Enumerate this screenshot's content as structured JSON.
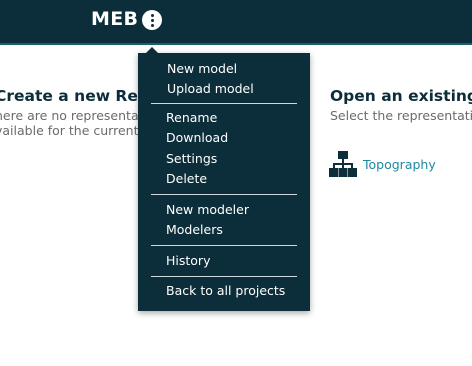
{
  "header": {
    "project_title": "MEB"
  },
  "left_section": {
    "heading": "Create a new Repr",
    "description_line1": "here are no representa",
    "description_line2": "vailable for the current"
  },
  "right_section": {
    "heading": "Open an existing R",
    "description": "Select the representation"
  },
  "representations": [
    {
      "label": "Topography",
      "icon": "hierarchy-icon"
    }
  ],
  "menu": {
    "groups": [
      [
        {
          "label": "New model"
        },
        {
          "label": "Upload model"
        }
      ],
      [
        {
          "label": "Rename"
        },
        {
          "label": "Download"
        },
        {
          "label": "Settings"
        },
        {
          "label": "Delete"
        }
      ],
      [
        {
          "label": "New modeler"
        },
        {
          "label": "Modelers"
        }
      ],
      [
        {
          "label": "History"
        }
      ],
      [
        {
          "label": "Back to all projects"
        }
      ]
    ]
  },
  "colors": {
    "header_bg": "#0c2d3a",
    "menu_bg": "#0c2d3a",
    "link": "#1e8aa0",
    "heading": "#0c2d3a"
  }
}
